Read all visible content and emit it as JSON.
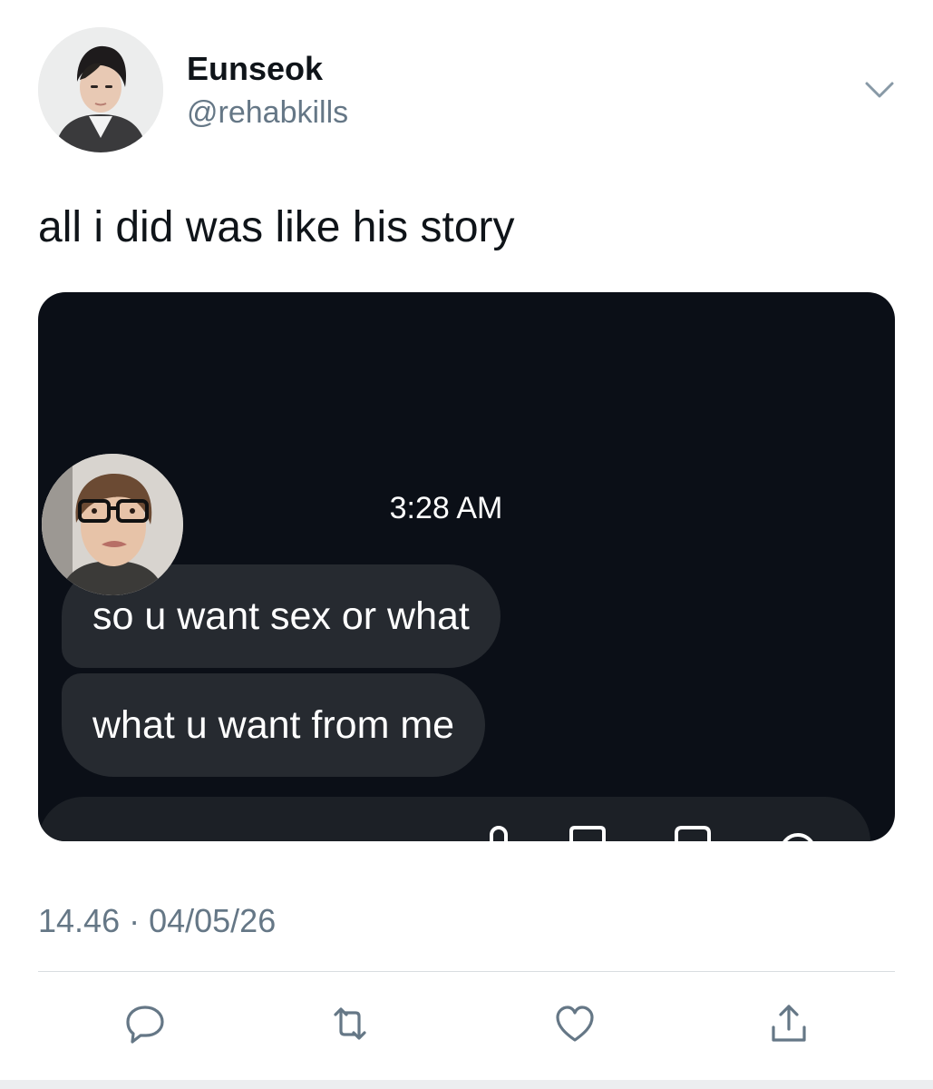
{
  "tweet": {
    "author": {
      "display_name": "Eunseok",
      "handle": "@rehabkills"
    },
    "text": "all i did was like his story",
    "timestamp": "14.46 · 04/05/26",
    "menu_icon": "chevron-down-icon"
  },
  "media": {
    "dm_time": "3:28 AM",
    "messages": [
      "so u want sex or what",
      "what u want from me"
    ]
  },
  "actions": {
    "reply_icon": "reply-icon",
    "retweet_icon": "retweet-icon",
    "like_icon": "heart-icon",
    "share_icon": "share-icon"
  },
  "colors": {
    "secondary_text": "#657786",
    "media_background": "#0b0f17",
    "bubble": "#262a30"
  }
}
